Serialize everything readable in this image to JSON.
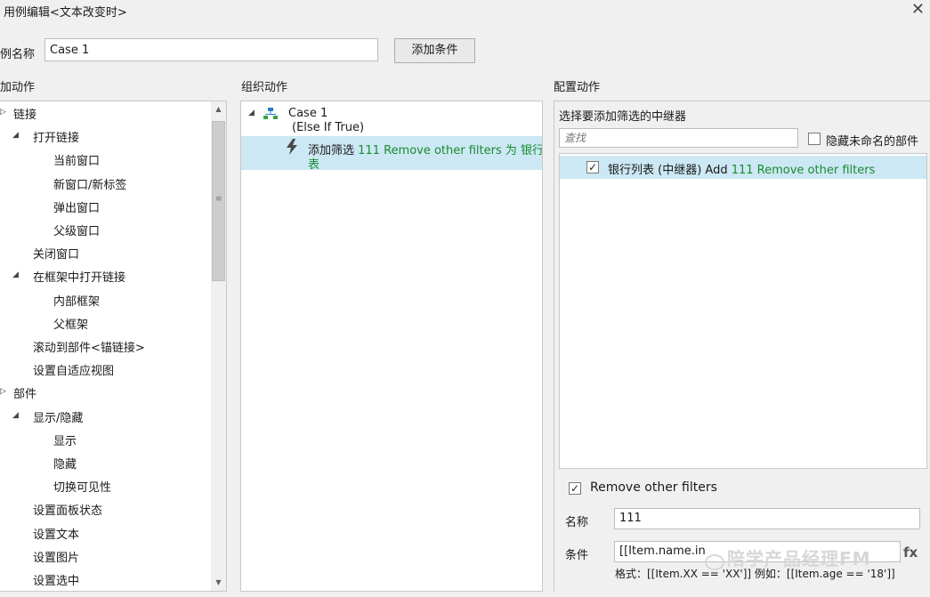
{
  "window": {
    "title": "用例编辑<文本改变时>",
    "close_glyph": "✕"
  },
  "case_name": {
    "label": "例名称",
    "value": "Case 1",
    "add_condition_label": "添加条件"
  },
  "left": {
    "header": "加动作",
    "items": [
      {
        "label": "链接",
        "level": 0,
        "expander": "closed"
      },
      {
        "label": "打开链接",
        "level": 1,
        "expander": "open"
      },
      {
        "label": "当前窗口",
        "level": 2
      },
      {
        "label": "新窗口/新标签",
        "level": 2
      },
      {
        "label": "弹出窗口",
        "level": 2
      },
      {
        "label": "父级窗口",
        "level": 2
      },
      {
        "label": "关闭窗口",
        "level": 1
      },
      {
        "label": "在框架中打开链接",
        "level": 1,
        "expander": "open"
      },
      {
        "label": "内部框架",
        "level": 2
      },
      {
        "label": "父框架",
        "level": 2
      },
      {
        "label": "滚动到部件<锚链接>",
        "level": 1
      },
      {
        "label": "设置自适应视图",
        "level": 1
      },
      {
        "label": "部件",
        "level": 0,
        "expander": "closed"
      },
      {
        "label": "显示/隐藏",
        "level": 1,
        "expander": "open"
      },
      {
        "label": "显示",
        "level": 2
      },
      {
        "label": "隐藏",
        "level": 2
      },
      {
        "label": "切换可见性",
        "level": 2
      },
      {
        "label": "设置面板状态",
        "level": 1
      },
      {
        "label": "设置文本",
        "level": 1
      },
      {
        "label": "设置图片",
        "level": 1
      },
      {
        "label": "设置选中",
        "level": 1
      }
    ]
  },
  "middle": {
    "header": "组织动作",
    "case_title": "Case 1",
    "case_condition": "(Else If True)",
    "action_prefix": "添加筛选 ",
    "action_green_1": "111 Remove other filters 为 银行列",
    "action_green_2": "表"
  },
  "right": {
    "header": "配置动作",
    "subheader": "选择要添加筛选的中继器",
    "search_placeholder": "查找",
    "hide_unnamed_label": "隐藏未命名的部件",
    "repeater_item_prefix": "银行列表 (中继器) Add ",
    "repeater_item_green": "111 Remove other filters",
    "remove_other_filters_label": "Remove other filters",
    "name_label": "名称",
    "name_value": "111",
    "condition_label": "条件",
    "condition_value": "[[Item.name.in",
    "format_hint": "格式：[[Item.XX == 'XX']] 例如：[[Item.age == '18']]"
  },
  "watermark": {
    "text": "陪学产品经理FM",
    "fx": "fx"
  },
  "colors": {
    "selection": "#cce8f4",
    "green_text": "#1a8a2f"
  }
}
